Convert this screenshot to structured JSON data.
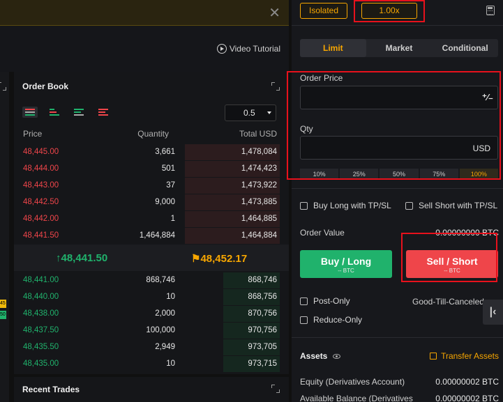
{
  "banner": {
    "close_label": "✕"
  },
  "toolbar": {
    "video_tutorial": "Video Tutorial"
  },
  "order_book": {
    "title": "Order Book",
    "precision": "0.5",
    "headers": {
      "price": "Price",
      "quantity": "Quantity",
      "total": "Total USD"
    },
    "asks": [
      {
        "price": "48,445.00",
        "qty": "3,661",
        "total": "1,478,084",
        "depth": 0.37
      },
      {
        "price": "48,444.00",
        "qty": "501",
        "total": "1,474,423",
        "depth": 0.37
      },
      {
        "price": "48,443.00",
        "qty": "37",
        "total": "1,473,922",
        "depth": 0.37
      },
      {
        "price": "48,442.50",
        "qty": "9,000",
        "total": "1,473,885",
        "depth": 0.37
      },
      {
        "price": "48,442.00",
        "qty": "1",
        "total": "1,464,885",
        "depth": 0.37
      },
      {
        "price": "48,441.50",
        "qty": "1,464,884",
        "total": "1,464,884",
        "depth": 0.37
      }
    ],
    "last_price": "48,441.50",
    "mark_price": "48,452.17",
    "bids": [
      {
        "price": "48,441.00",
        "qty": "868,746",
        "total": "868,746",
        "depth": 0.22
      },
      {
        "price": "48,440.00",
        "qty": "10",
        "total": "868,756",
        "depth": 0.22
      },
      {
        "price": "48,438.00",
        "qty": "2,000",
        "total": "870,756",
        "depth": 0.22
      },
      {
        "price": "48,437.50",
        "qty": "100,000",
        "total": "970,756",
        "depth": 0.22
      },
      {
        "price": "48,435.50",
        "qty": "2,949",
        "total": "973,705",
        "depth": 0.22
      },
      {
        "price": "48,435.00",
        "qty": "10",
        "total": "973,715",
        "depth": 0.22
      }
    ]
  },
  "recent_trades": {
    "title": "Recent Trades"
  },
  "left_strip": {
    "badge_a": "45",
    "badge_b": "50"
  },
  "panel": {
    "margin_mode": "Isolated",
    "leverage": "1.00x",
    "tabs": [
      "Limit",
      "Market",
      "Conditional"
    ],
    "order_price_label": "Order Price",
    "order_price_value": "",
    "qty_label": "Qty",
    "qty_value": "",
    "qty_unit": "USD",
    "percent_options": [
      "10%",
      "25%",
      "50%",
      "75%",
      "100%"
    ],
    "buy_long_tpsl": "Buy Long with TP/SL",
    "sell_short_tpsl": "Sell Short with TP/SL",
    "order_value_label": "Order Value",
    "order_value": "0.00000000 BTC",
    "buy_label": "Buy / Long",
    "buy_sub": "-- BTC",
    "sell_label": "Sell / Short",
    "sell_sub": "-- BTC",
    "post_only": "Post-Only",
    "time_in_force": "Good-Till-Canceled",
    "reduce_only": "Reduce-Only",
    "assets_label": "Assets",
    "transfer_assets": "Transfer Assets",
    "equity_label": "Equity (Derivatives Account)",
    "equity_value": "0.00000002 BTC",
    "avail_label": "Available Balance (Derivatives",
    "avail_value": "0.00000002 BTC"
  },
  "colors": {
    "accent": "#f7a600",
    "buy": "#20b26c",
    "sell": "#ef454a",
    "highlight_box": "#e8111c"
  }
}
